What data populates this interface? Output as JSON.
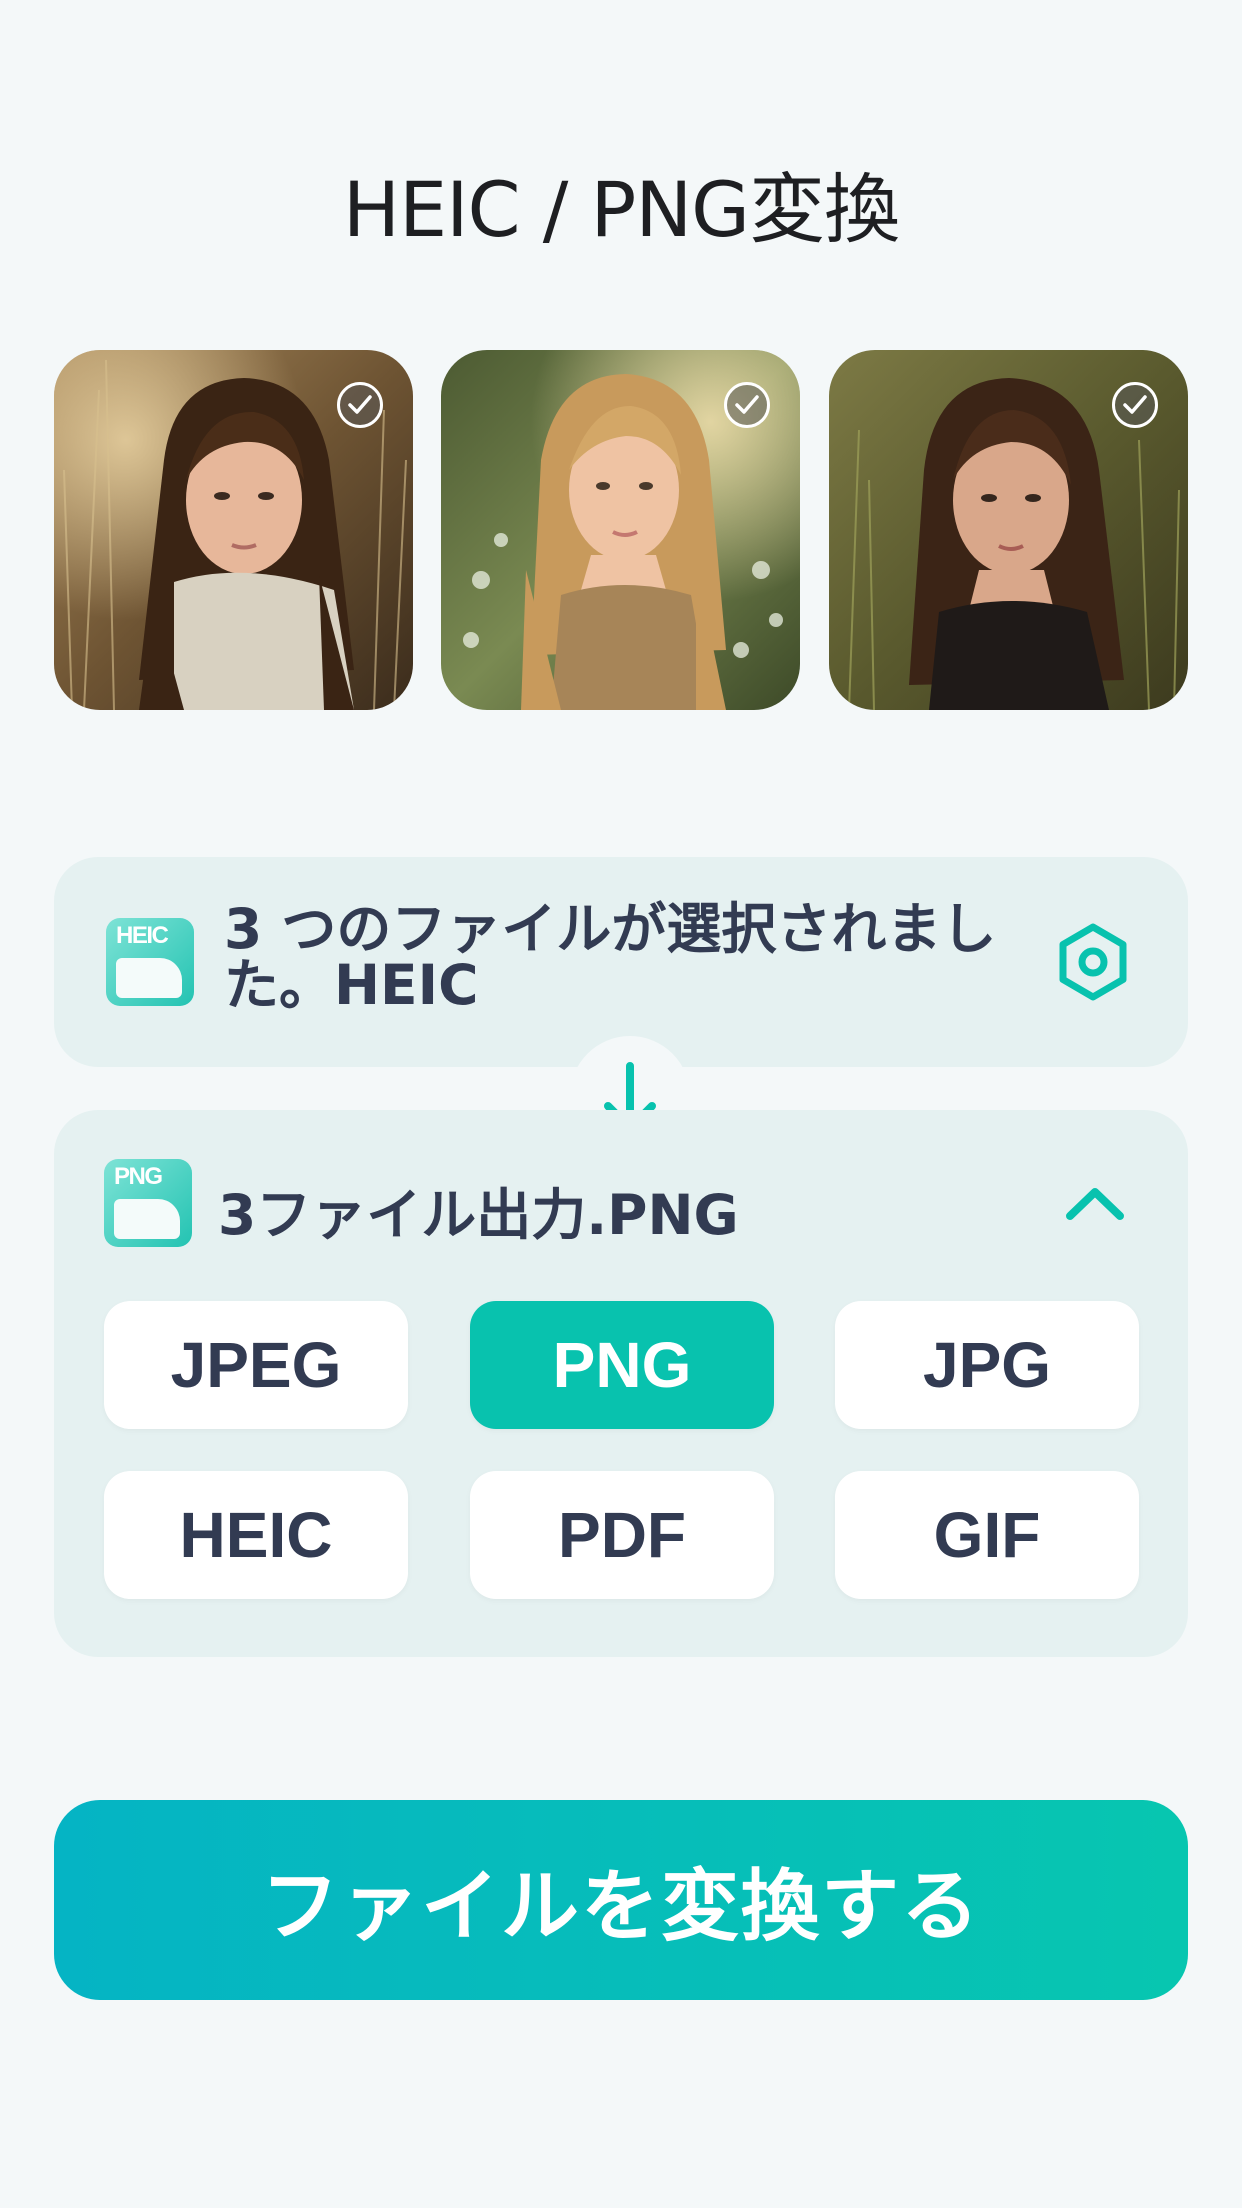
{
  "header": {
    "title": "HEIC / PNG変換"
  },
  "photos": [
    {
      "name": "photo-1",
      "selected": true
    },
    {
      "name": "photo-2",
      "selected": true
    },
    {
      "name": "photo-3",
      "selected": true
    }
  ],
  "source": {
    "icon_label": "HEIC",
    "text": "3 つのファイルが選択されました。HEIC",
    "settings_icon": "settings-hexagon-icon"
  },
  "output": {
    "icon_label": "PNG",
    "text": "3ファイル出力.PNG",
    "collapse_icon": "chevron-up-icon",
    "formats": [
      "JPEG",
      "PNG",
      "JPG",
      "HEIC",
      "PDF",
      "GIF"
    ],
    "selected": "PNG"
  },
  "actions": {
    "convert_label": "ファイルを変換する"
  },
  "colors": {
    "accent": "#08c2ae",
    "card_bg": "#e5f1f1",
    "text": "#323b52",
    "button_gradient_start": "#05b4c4",
    "button_gradient_end": "#07c6b0"
  }
}
